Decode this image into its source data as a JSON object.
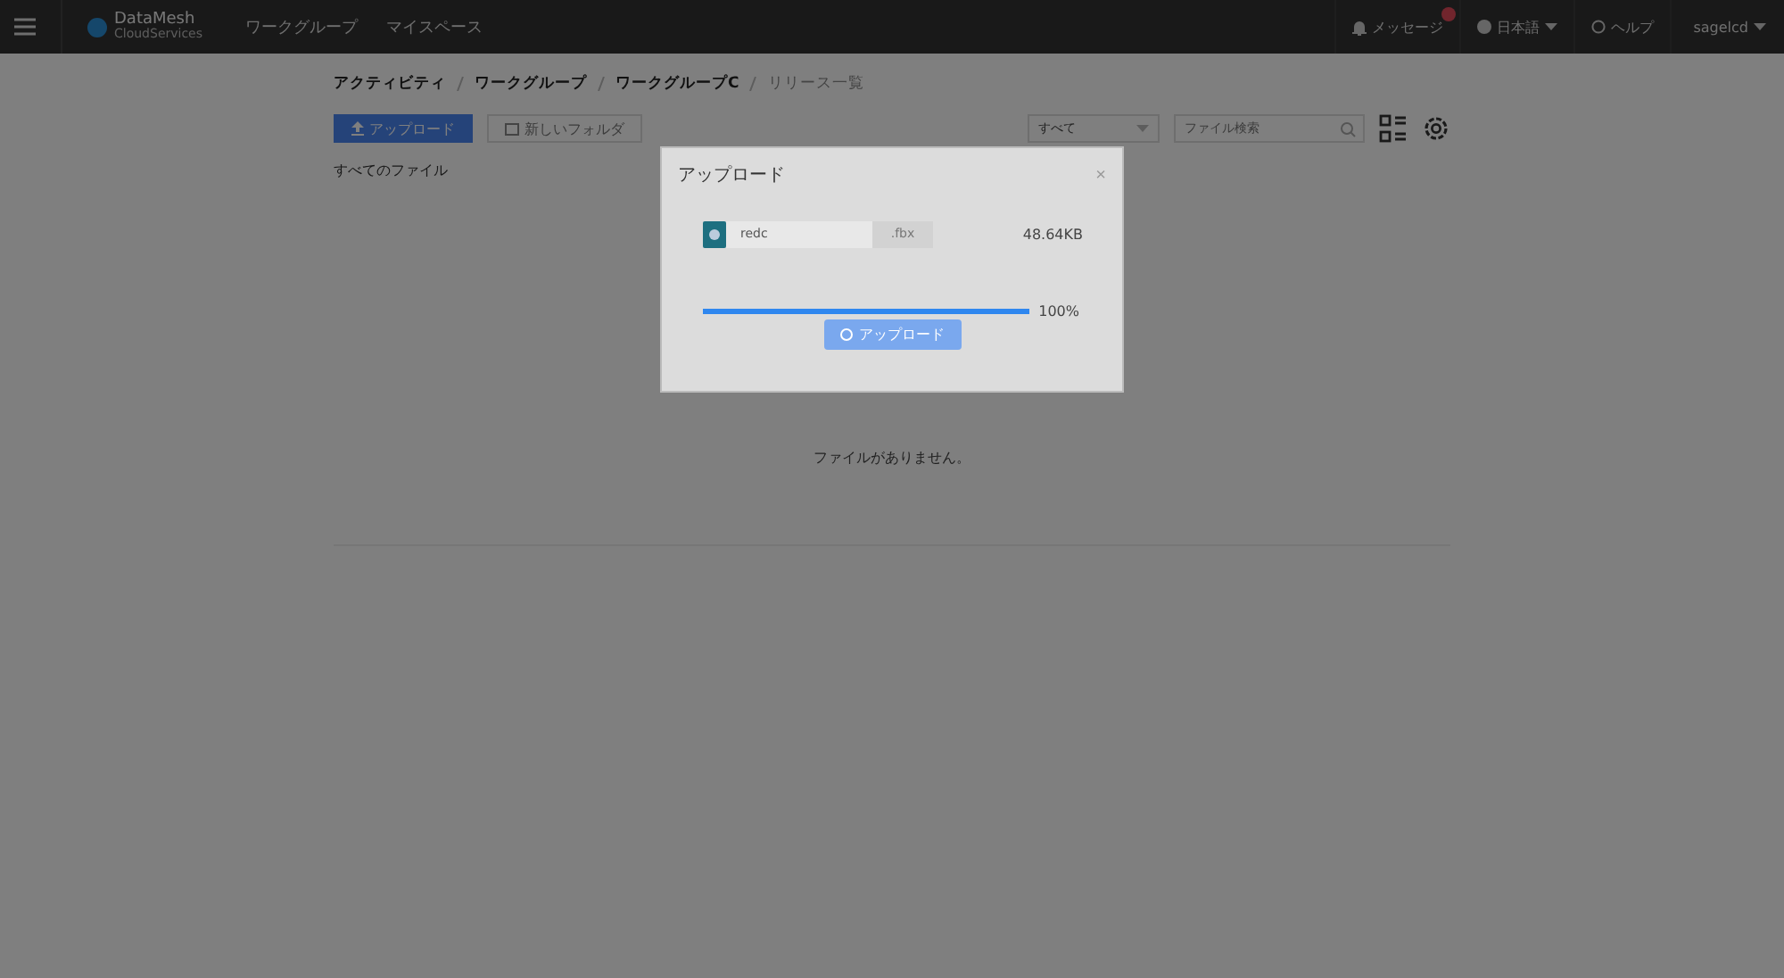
{
  "nav": {
    "brand": {
      "name": "DataMesh",
      "sub": "CloudServices"
    },
    "links": [
      "ワークグループ",
      "マイスペース"
    ],
    "messages": {
      "label": "メッセージ",
      "unread": true
    },
    "language": "日本語",
    "help": "ヘルプ",
    "user": "sagelcd"
  },
  "breadcrumb": [
    {
      "label": "アクティビティ",
      "current": false
    },
    {
      "label": "ワークグループ",
      "current": false
    },
    {
      "label": "ワークグループC",
      "current": false
    },
    {
      "label": "リリース一覧",
      "current": true
    }
  ],
  "toolbar": {
    "upload": "アップロード",
    "new_folder": "新しいフォルダ",
    "filter": "すべて",
    "search": {
      "placeholder": "ファイル検索"
    }
  },
  "section_title": "すべてのファイル",
  "empty_text": "ファイルがありません。",
  "dialog": {
    "title": "アップロード",
    "close": "×",
    "file": {
      "name": "redc",
      "ext": ".fbx",
      "size": "48.64KB"
    },
    "progress": {
      "level": 1,
      "reading": "100%"
    },
    "button": {
      "label": "アップロード",
      "disabled": true
    }
  }
}
